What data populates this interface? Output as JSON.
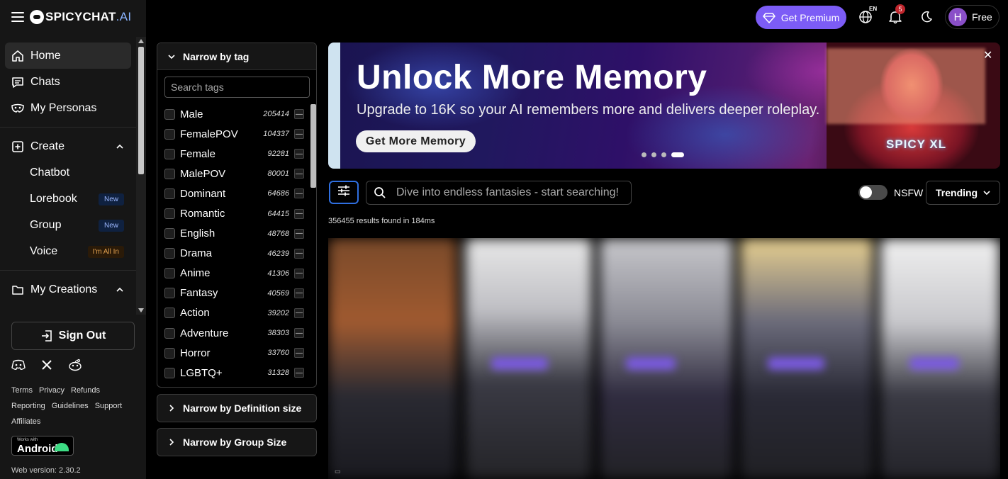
{
  "brand": {
    "name": "SPICYCHAT",
    "suffix": ".AI"
  },
  "nav": {
    "home": "Home",
    "chats": "Chats",
    "personas": "My Personas",
    "create": "Create",
    "chatbot": "Chatbot",
    "lorebook": "Lorebook",
    "lorebook_badge": "New",
    "group": "Group",
    "group_badge": "New",
    "voice": "Voice",
    "voice_badge": "I'm All In",
    "my_creations": "My Creations"
  },
  "sidebar_footer": {
    "sign_out": "Sign Out",
    "links": [
      "Terms",
      "Privacy",
      "Refunds",
      "Reporting",
      "Guidelines",
      "Support",
      "Affiliates"
    ],
    "android_small": "Works with",
    "android_big": "Android",
    "version": "Web version: 2.30.2"
  },
  "header": {
    "premium": "Get Premium",
    "lang": "EN",
    "notifications": "5",
    "user_initial": "H",
    "plan": "Free"
  },
  "tags_panel": {
    "title": "Narrow by tag",
    "search_placeholder": "Search tags",
    "minus": "—",
    "tags": [
      {
        "name": "Male",
        "count": "205414"
      },
      {
        "name": "FemalePOV",
        "count": "104337"
      },
      {
        "name": "Female",
        "count": "92281"
      },
      {
        "name": "MalePOV",
        "count": "80001"
      },
      {
        "name": "Dominant",
        "count": "64686"
      },
      {
        "name": "Romantic",
        "count": "64415"
      },
      {
        "name": "English",
        "count": "48768"
      },
      {
        "name": "Drama",
        "count": "46239"
      },
      {
        "name": "Anime",
        "count": "41306"
      },
      {
        "name": "Fantasy",
        "count": "40569"
      },
      {
        "name": "Action",
        "count": "39202"
      },
      {
        "name": "Adventure",
        "count": "38303"
      },
      {
        "name": "Horror",
        "count": "33760"
      },
      {
        "name": "LGBTQ+",
        "count": "31328"
      }
    ]
  },
  "definition_panel": {
    "title": "Narrow by Definition size"
  },
  "group_panel": {
    "title": "Narrow by Group Size"
  },
  "banner": {
    "title": "Unlock More Memory",
    "subtitle": "Upgrade to 16K so your AI remembers more and delivers deeper roleplay.",
    "button": "Get More Memory",
    "art_text": "SPICY XL",
    "close": "✕"
  },
  "search": {
    "placeholder": "Dive into endless fantasies - start searching!",
    "nsfw_label": "NSFW",
    "sort": "Trending",
    "results": "356455 results found in 184ms"
  }
}
